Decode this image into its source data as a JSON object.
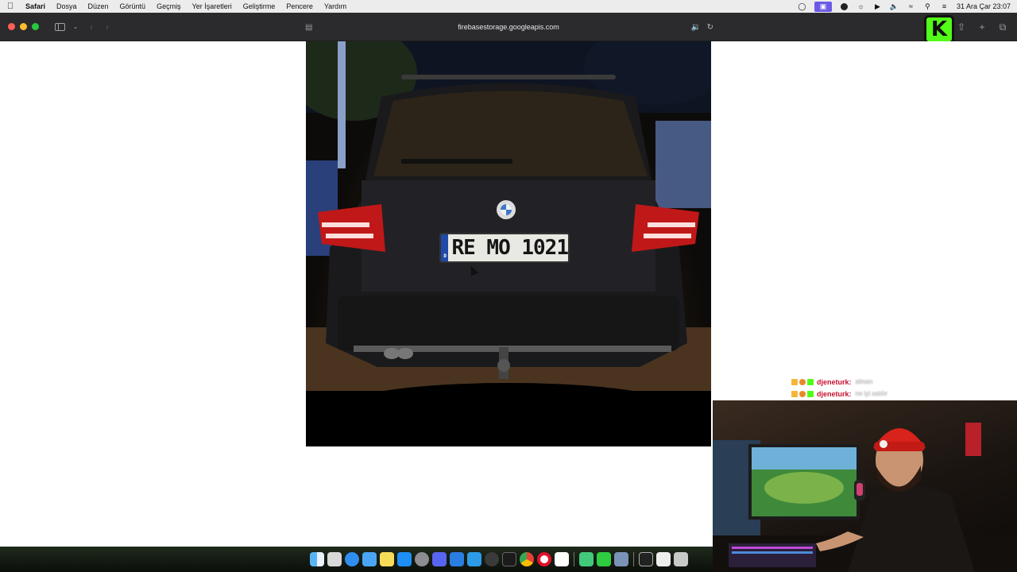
{
  "menubar": {
    "app_name": "Safari",
    "items": [
      "Dosya",
      "Düzen",
      "Görüntü",
      "Geçmiş",
      "Yer İşaretleri",
      "Geliştirme",
      "Pencere",
      "Yardım"
    ],
    "clock": "31 Ara Çar  23:07",
    "status_icons": [
      "screen-share-icon",
      "stage-manager-icon",
      "record-icon",
      "creative-cloud-icon",
      "play-icon",
      "volume-icon",
      "wifi-icon",
      "search-icon",
      "control-center-icon"
    ]
  },
  "browser": {
    "url": "firebasestorage.googleapis.com",
    "back_enabled": false,
    "forward_enabled": false,
    "audio_playing": true
  },
  "image": {
    "plate_text": "RE MO 1021",
    "plate_country": "D"
  },
  "stream": {
    "chat": [
      {
        "user": "djeneturk:",
        "message": "alman"
      },
      {
        "user": "djeneturk:",
        "message": "ne iyi satılır"
      }
    ]
  },
  "dock": {
    "icons": [
      "finder-icon",
      "launchpad-icon",
      "safari-icon",
      "mail-icon",
      "notes-icon",
      "app-store-icon",
      "settings-icon",
      "discord-icon",
      "xcode-icon",
      "mail-alt-icon",
      "activity-icon",
      "terminal-icon",
      "chrome-icon",
      "opera-icon",
      "app-store-alt-icon",
      "files-icon",
      "messages-icon",
      "preview-icon",
      "window-icon",
      "window-alt-icon",
      "trash-icon"
    ]
  },
  "colors": {
    "accent_kick": "#53fc18",
    "traffic_close": "#fe5f57",
    "traffic_min": "#febc2e",
    "traffic_max": "#28c840"
  }
}
